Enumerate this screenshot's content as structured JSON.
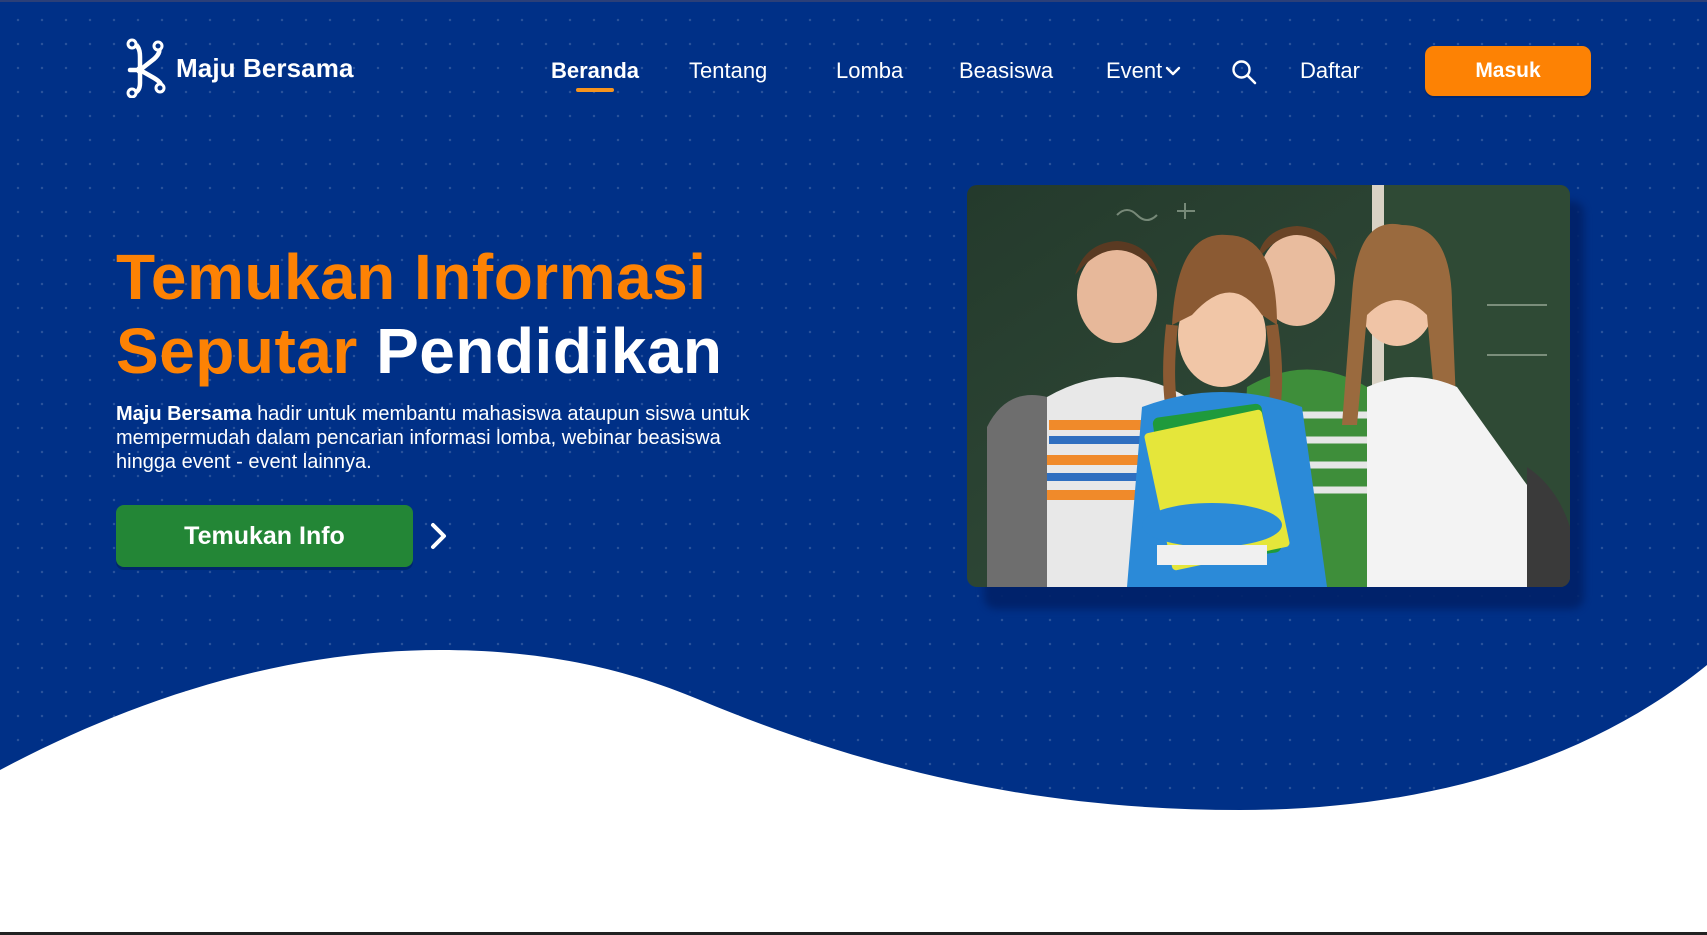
{
  "brand": {
    "name": "Maju Bersama",
    "icon": "network-nodes-logo",
    "primary_color": "#003087",
    "accent_color": "#fd8204",
    "cta_color": "#238636"
  },
  "nav": {
    "items": [
      {
        "label": "Beranda",
        "active": true
      },
      {
        "label": "Tentang",
        "active": false
      },
      {
        "label": "Lomba",
        "active": false
      },
      {
        "label": "Beasiswa",
        "active": false
      },
      {
        "label": "Event",
        "active": false,
        "has_dropdown": true
      }
    ],
    "search_icon": "search-icon",
    "register_label": "Daftar",
    "login_label": "Masuk"
  },
  "hero": {
    "headline_orange_1": "Temukan Informasi",
    "headline_orange_2": "Seputar",
    "headline_white": "Pendidikan",
    "description_bold": "Maju Bersama",
    "description_rest": " hadir untuk membantu mahasiswa ataupun siswa untuk mempermudah dalam pencarian informasi lomba, webinar beasiswa hingga event - event lainnya.",
    "cta_label": "Temukan Info",
    "cta_arrow_icon": "chevron-right-icon",
    "image_icon": "students-group-photo"
  }
}
